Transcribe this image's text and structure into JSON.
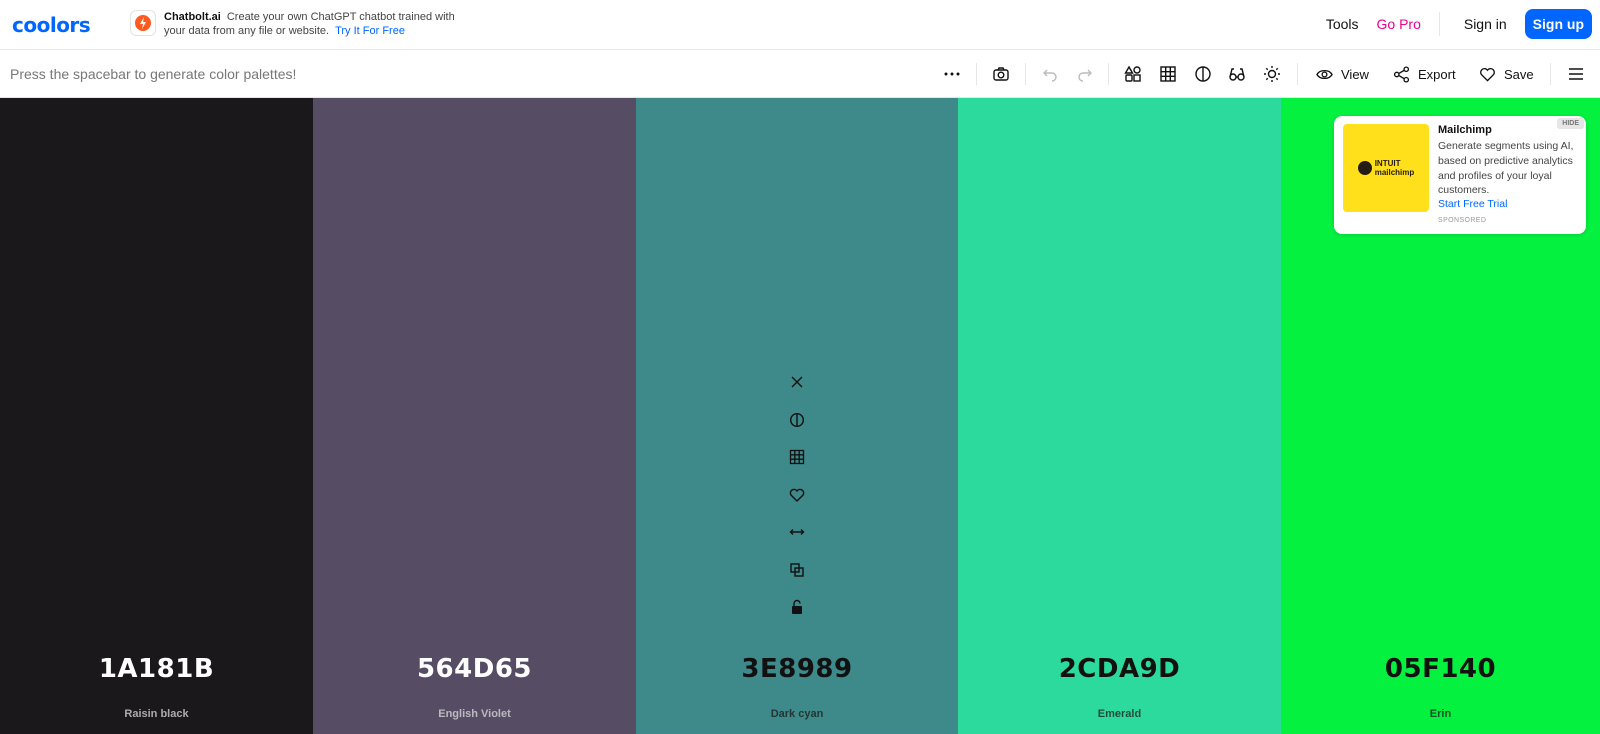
{
  "header": {
    "logo": "coolors",
    "promo": {
      "brand": "Chatbolt.ai",
      "text": "Create your own ChatGPT chatbot trained with your data from any file or website.",
      "link": "Try It For Free"
    },
    "nav": {
      "tools": "Tools",
      "go_pro": "Go Pro",
      "sign_in": "Sign in",
      "sign_up": "Sign up"
    }
  },
  "toolbar": {
    "hint": "Press the spacebar to generate color palettes!",
    "icons": [
      "more-icon",
      "camera-icon",
      "undo-icon",
      "redo-icon",
      "shapes-icon",
      "grid-icon",
      "contrast-icon",
      "glasses-icon",
      "brightness-icon",
      "menu-icon"
    ],
    "view": "View",
    "export": "Export",
    "save": "Save"
  },
  "palette": {
    "colors": [
      {
        "hex": "1A181B",
        "name": "Raisin black",
        "color": "#1A181B",
        "tone": "light"
      },
      {
        "hex": "564D65",
        "name": "English Violet",
        "color": "#564D65",
        "tone": "light"
      },
      {
        "hex": "3E8989",
        "name": "Dark cyan",
        "color": "#3E8989",
        "tone": "dark"
      },
      {
        "hex": "2CDA9D",
        "name": "Emerald",
        "color": "#2CDA9D",
        "tone": "dark"
      },
      {
        "hex": "05F140",
        "name": "Erin",
        "color": "#05F140",
        "tone": "dark"
      }
    ],
    "hovered_tools": [
      "close-icon",
      "contrast-icon",
      "shades-grid-icon",
      "heart-icon",
      "drag-icon",
      "copy-icon",
      "unlock-icon"
    ]
  },
  "ad": {
    "logo_line1": "INTUIT",
    "logo_line2": "mailchimp",
    "title": "Mailchimp",
    "body": "Generate segments using AI, based on predictive analytics and profiles of your loyal customers.",
    "cta": "Start Free Trial",
    "sponsored": "SPONSORED",
    "hide": "HIDE"
  },
  "colors": {
    "accent": "#0066ff",
    "pro": "#ec008c",
    "ad_bg": "#ffe01b"
  }
}
